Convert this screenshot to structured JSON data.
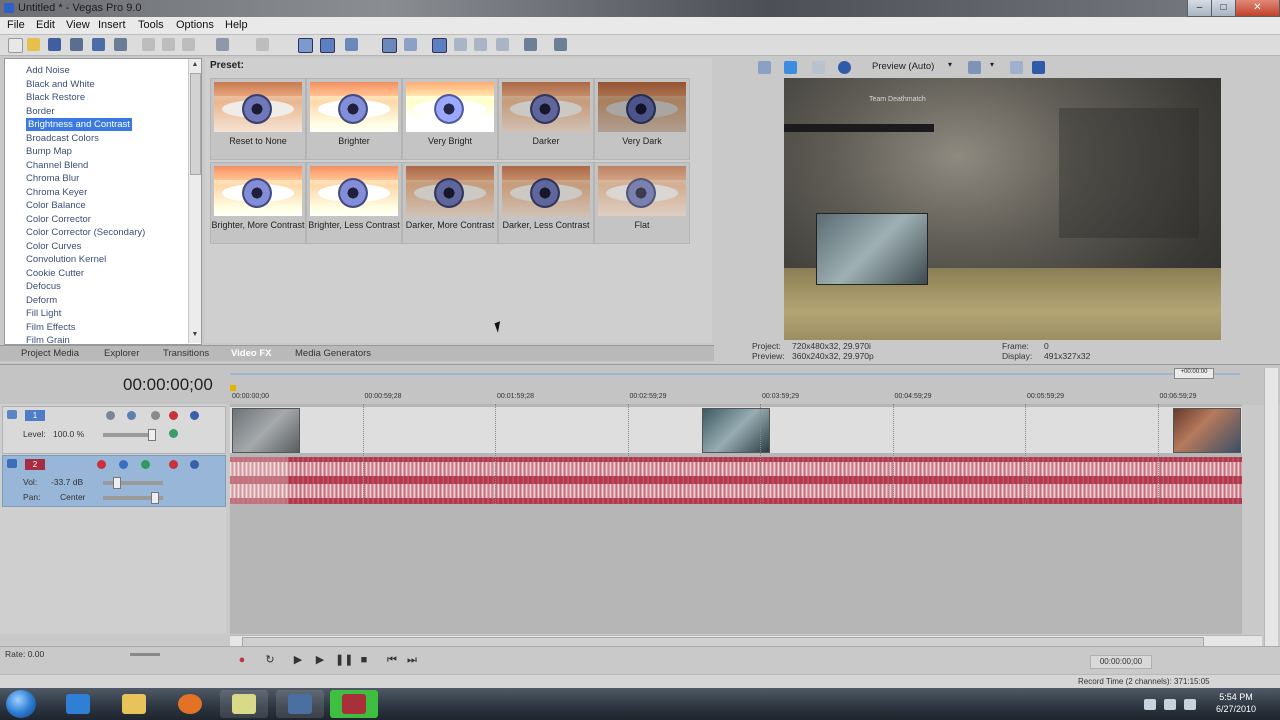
{
  "window": {
    "title": "Untitled * - Vegas Pro 9.0"
  },
  "menu": [
    "File",
    "Edit",
    "View",
    "Insert",
    "Tools",
    "Options",
    "Help"
  ],
  "fx_list": {
    "selected_index": 4,
    "items": [
      "Add Noise",
      "Black and White",
      "Black Restore",
      "Border",
      "Brightness and Contrast",
      "Broadcast Colors",
      "Bump Map",
      "Channel Blend",
      "Chroma Blur",
      "Chroma Keyer",
      "Color Balance",
      "Color Corrector",
      "Color Corrector (Secondary)",
      "Color Curves",
      "Convolution Kernel",
      "Cookie Cutter",
      "Defocus",
      "Deform",
      "Fill Light",
      "Film Effects",
      "Film Grain"
    ]
  },
  "presets": {
    "label": "Preset:",
    "items": [
      {
        "label": "Reset to None",
        "tone": "none"
      },
      {
        "label": "Brighter",
        "tone": "bright"
      },
      {
        "label": "Very Bright",
        "tone": "verybright"
      },
      {
        "label": "Darker",
        "tone": "dark"
      },
      {
        "label": "Very Dark",
        "tone": "verydark"
      },
      {
        "label": "Brighter, More Contrast",
        "tone": "bright"
      },
      {
        "label": "Brighter, Less Contrast",
        "tone": "bright"
      },
      {
        "label": "Darker, More Contrast",
        "tone": "dark"
      },
      {
        "label": "Darker, Less Contrast",
        "tone": "dark"
      },
      {
        "label": "Flat",
        "tone": "flat"
      }
    ]
  },
  "tabs": {
    "active": "Video FX",
    "items": [
      "Project Media",
      "Explorer",
      "Transitions",
      "Video FX",
      "Media Generators"
    ]
  },
  "preview": {
    "mode": "Preview (Auto)",
    "screen_title": "Team Deathmatch",
    "project_label": "Project:",
    "project_value": "720x480x32, 29.970i",
    "preview_label": "Preview:",
    "preview_value": "360x240x32, 29.970p",
    "frame_label": "Frame:",
    "frame_value": "0",
    "display_label": "Display:",
    "display_value": "491x327x32"
  },
  "timeline": {
    "timecode": "00:00:00;00",
    "ruler": [
      "00:00:00;00",
      "00:00:59;28",
      "00:01:59;28",
      "00:02:59;29",
      "00:03:59;29",
      "00:04:59;29",
      "00:05:59;29",
      "00:06:59;29"
    ],
    "loop_tag": "+00:00:00"
  },
  "tracks": {
    "video": {
      "number": "1",
      "level_label": "Level:",
      "level_value": "100.0 %"
    },
    "audio": {
      "number": "2",
      "vol_label": "Vol:",
      "vol_value": "-33.7 dB",
      "pan_label": "Pan:",
      "pan_value": "Center"
    }
  },
  "transport": {
    "rate_label": "Rate:",
    "rate_value": "0.00",
    "timecode": "00:00:00;00",
    "record_time": "Record Time (2 channels): 371:15:05"
  },
  "taskbar": {
    "time": "5:54 PM",
    "date": "6/27/2010"
  },
  "colors": {
    "selection": "#3a7ae0",
    "audio_track": "#b03a4c",
    "track_header_selected": "#98b7d8"
  }
}
